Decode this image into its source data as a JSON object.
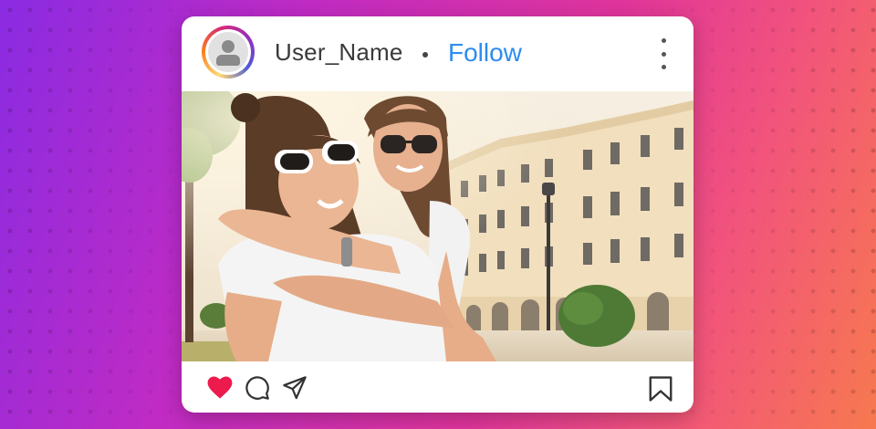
{
  "post": {
    "username": "User_Name",
    "follow_label": "Follow"
  },
  "icons": {
    "avatar": "user-avatar-icon",
    "more": "more-vertical-icon",
    "like": "heart-icon",
    "comment": "comment-icon",
    "share": "send-icon",
    "save": "bookmark-icon"
  },
  "colors": {
    "follow": "#2d8cf0",
    "like": "#ed1a4d",
    "background_start": "#8a2be2",
    "background_end": "#f7794f"
  }
}
